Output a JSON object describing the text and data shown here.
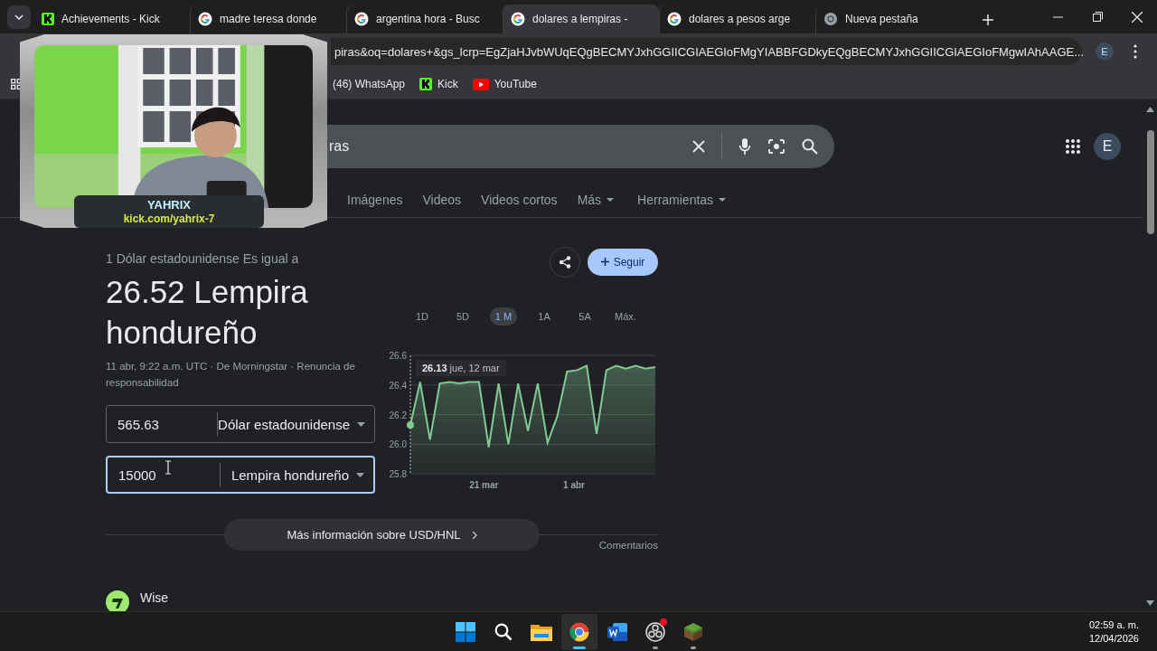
{
  "browser": {
    "tabs": [
      {
        "title": "Achievements - Kick",
        "kind": "kick",
        "selected": false
      },
      {
        "title": "madre teresa donde",
        "kind": "google",
        "selected": false
      },
      {
        "title": "argentina hora - Busc",
        "kind": "google",
        "selected": false
      },
      {
        "title": "dolares a lempiras -",
        "kind": "google",
        "selected": true
      },
      {
        "title": "dolares a pesos arge",
        "kind": "google",
        "selected": false
      },
      {
        "title": "Nueva pestaña",
        "kind": "chrome",
        "selected": false
      }
    ],
    "address_bar": {
      "url": "piras&oq=dolares+&gs_lcrp=EgZjaHJvbWUqEQgBECMYJxhGGIICGIAEGIoFMgYIABBFGDkyEQgBECMYJxhGGIICGIAEGIoFMgwIAhAAGE..."
    },
    "profile_initial": "E",
    "bookmarks": [
      {
        "label": "(46) WhatsApp",
        "kind": "none"
      },
      {
        "label": "Kick",
        "kind": "kick"
      },
      {
        "label": "YouTube",
        "kind": "youtube"
      }
    ]
  },
  "search": {
    "query": "ras",
    "avatar": "E",
    "nav": [
      {
        "label": "Imágenes",
        "dropdown": false
      },
      {
        "label": "Videos",
        "dropdown": false
      },
      {
        "label": "Videos cortos",
        "dropdown": false
      },
      {
        "label": "Más",
        "dropdown": true
      },
      {
        "label": "Herramientas",
        "dropdown": true
      }
    ]
  },
  "converter": {
    "heading": "1 Dólar estadounidense Es igual a",
    "result": "26.52 Lempira hondureño",
    "source": "11 abr, 9:22 a.m. UTC · De Morningstar · Renuncia de responsabilidad",
    "rows": [
      {
        "amount": "565.63",
        "currency": "Dólar estadounidense",
        "focused": false
      },
      {
        "amount": "15000",
        "currency": "Lempira hondureño",
        "focused": true
      }
    ],
    "follow_label": "Seguir",
    "ranges": [
      {
        "label": "1D",
        "selected": false
      },
      {
        "label": "5D",
        "selected": false
      },
      {
        "label": "1 M",
        "selected": true
      },
      {
        "label": "1A",
        "selected": false
      },
      {
        "label": "5A",
        "selected": false
      },
      {
        "label": "Máx.",
        "selected": false
      }
    ],
    "tooltip": "**26.13** jue, 12 mar",
    "chart_data": {
      "type": "area",
      "grid": true,
      "series": [
        {
          "color": "#81c995",
          "values": [
            26.13,
            26.42,
            26.03,
            26.41,
            26.42,
            26.41,
            26.42,
            26.42,
            25.98,
            26.41,
            26.0,
            26.41,
            26.09,
            26.41,
            26.01,
            26.19,
            26.49,
            26.5,
            26.53,
            26.07,
            26.5,
            26.53,
            26.51,
            26.53,
            26.51,
            26.52
          ]
        }
      ],
      "ylim": [
        25.8,
        26.6
      ],
      "yticks": [
        {
          "value": 26.6,
          "label": "26.6"
        },
        {
          "value": 26.4,
          "label": "26.4"
        },
        {
          "value": 26.2,
          "label": "26.2"
        },
        {
          "value": 26.0,
          "label": "26.0"
        },
        {
          "value": 25.8,
          "label": "25.8"
        }
      ]
    },
    "x_axis_labels": [
      "21 mar",
      "1 abr"
    ],
    "more_link": "Más información sobre USD/HNL",
    "feedback": "Comentarios"
  },
  "result": {
    "site": "Wise"
  },
  "webcam": {
    "name": "YAHRIX",
    "link": "kick.com/yahrix-7"
  },
  "taskbar": {
    "apps": [
      {
        "kind": "start",
        "running": false,
        "active": false,
        "notification": false
      },
      {
        "kind": "search",
        "running": false,
        "active": false,
        "notification": false
      },
      {
        "kind": "files",
        "running": false,
        "active": false,
        "notification": false
      },
      {
        "kind": "chrome",
        "running": true,
        "active": true,
        "notification": false
      },
      {
        "kind": "word",
        "running": false,
        "active": false,
        "notification": false
      },
      {
        "kind": "obs",
        "running": true,
        "active": false,
        "notification": true
      },
      {
        "kind": "minecraft",
        "running": true,
        "active": false,
        "notification": false
      }
    ],
    "time": "02:59 a. m.",
    "date": "12/04/2026"
  }
}
